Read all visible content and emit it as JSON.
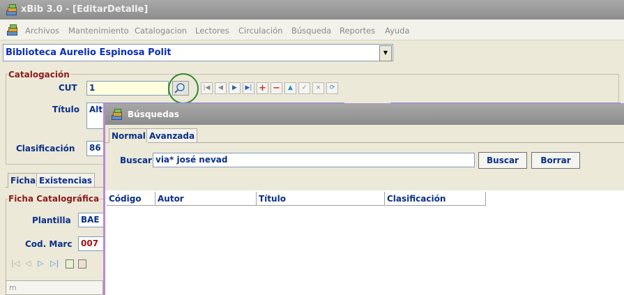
{
  "window": {
    "title": "xBib 3.0 - [EditarDetalle]"
  },
  "menu": [
    "Archivos",
    "Mantenimiento",
    "Catalogacion",
    "Lectores",
    "Circulación",
    "Búsqueda",
    "Reportes",
    "Ayuda"
  ],
  "library": {
    "selected": "Biblioteca Aurelio Espinosa Polit"
  },
  "catalogacion": {
    "group_title": "Catalogación",
    "cut_label": "CUT",
    "cut_value": "1",
    "titulo_label": "Título",
    "titulo_value": "Alt",
    "clasificacion_label": "Clasificación",
    "clasificacion_value": "86"
  },
  "tabs": [
    "Ficha",
    "Existencias"
  ],
  "ficha": {
    "group_title": "Ficha Catalográfica",
    "plantilla_label": "Plantilla",
    "plantilla_value": "BAE",
    "codmarc_label": "Cod. Marc",
    "codmarc_value": "007",
    "bottom_text": "m"
  },
  "dialog": {
    "title": "Búsquedas",
    "tabs": [
      "Normal",
      "Avanzada"
    ],
    "buscar_label": "Buscar",
    "buscar_value": "via* josé nevad",
    "buscar_button": "Buscar",
    "borrar_button": "Borrar",
    "columns": [
      "Código",
      "Autor",
      "Título",
      "Clasificación"
    ]
  },
  "icons": [
    "app-books-icon",
    "magnifier-icon",
    "first-record-icon",
    "previous-record-icon",
    "next-record-icon",
    "last-record-icon",
    "add-record-icon",
    "delete-record-icon",
    "edit-record-icon",
    "confirm-icon",
    "cancel-icon",
    "refresh-icon"
  ]
}
